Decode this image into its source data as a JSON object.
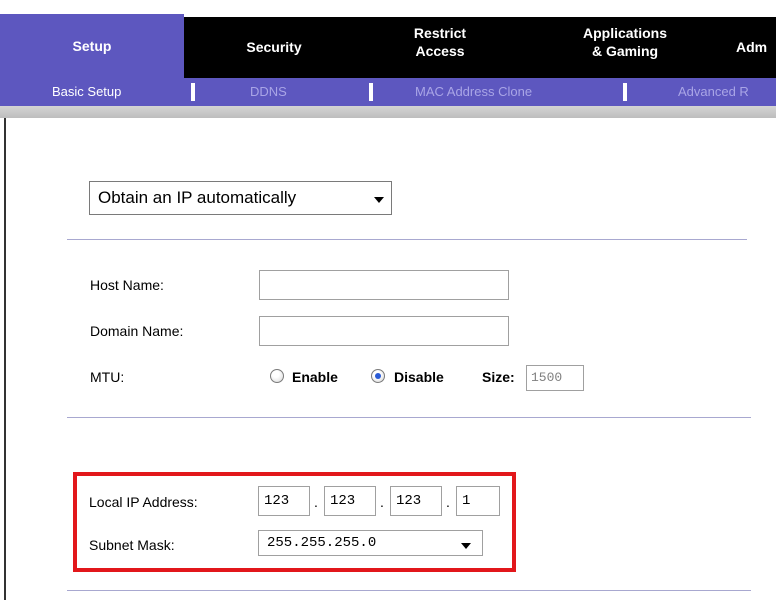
{
  "top_tabs": [
    {
      "label": "Setup"
    },
    {
      "label": "Security"
    },
    {
      "line1": "Restrict",
      "line2": "Access"
    },
    {
      "line1": "Applications",
      "line2": "& Gaming"
    },
    {
      "label": "Adm"
    }
  ],
  "sub_tabs": [
    {
      "label": "Basic Setup"
    },
    {
      "label": "DDNS"
    },
    {
      "label": "MAC Address Clone"
    },
    {
      "label": "Advanced R"
    }
  ],
  "connection_type": {
    "selected": "Obtain an IP automatically"
  },
  "optional_settings": {
    "host_name_label": "Host Name:",
    "host_name_value": "",
    "domain_name_label": "Domain Name:",
    "domain_name_value": "",
    "mtu_label": "MTU:",
    "mtu_enable_label": "Enable",
    "mtu_disable_label": "Disable",
    "mtu_selected": "Disable",
    "size_label": "Size:",
    "size_value": "1500"
  },
  "network_setup": {
    "local_ip_label": "Local IP Address:",
    "local_ip": [
      "123",
      "123",
      "123",
      "1"
    ],
    "dot": ".",
    "subnet_mask_label": "Subnet Mask:",
    "subnet_mask_value": "255.255.255.0"
  },
  "icons": {
    "dropdown": "chevron-down-icon",
    "radio": "radio-button"
  },
  "colors": {
    "setup_tab_bg": "#5d57bf",
    "tab_bar_bg": "#000000",
    "subbar_bg": "#5d57bf",
    "active_sub_text": "#ffffff",
    "inactive_sub_text": "#a9a5e6",
    "highlight_border": "#e2171b",
    "divider": "#a8a8d0"
  }
}
